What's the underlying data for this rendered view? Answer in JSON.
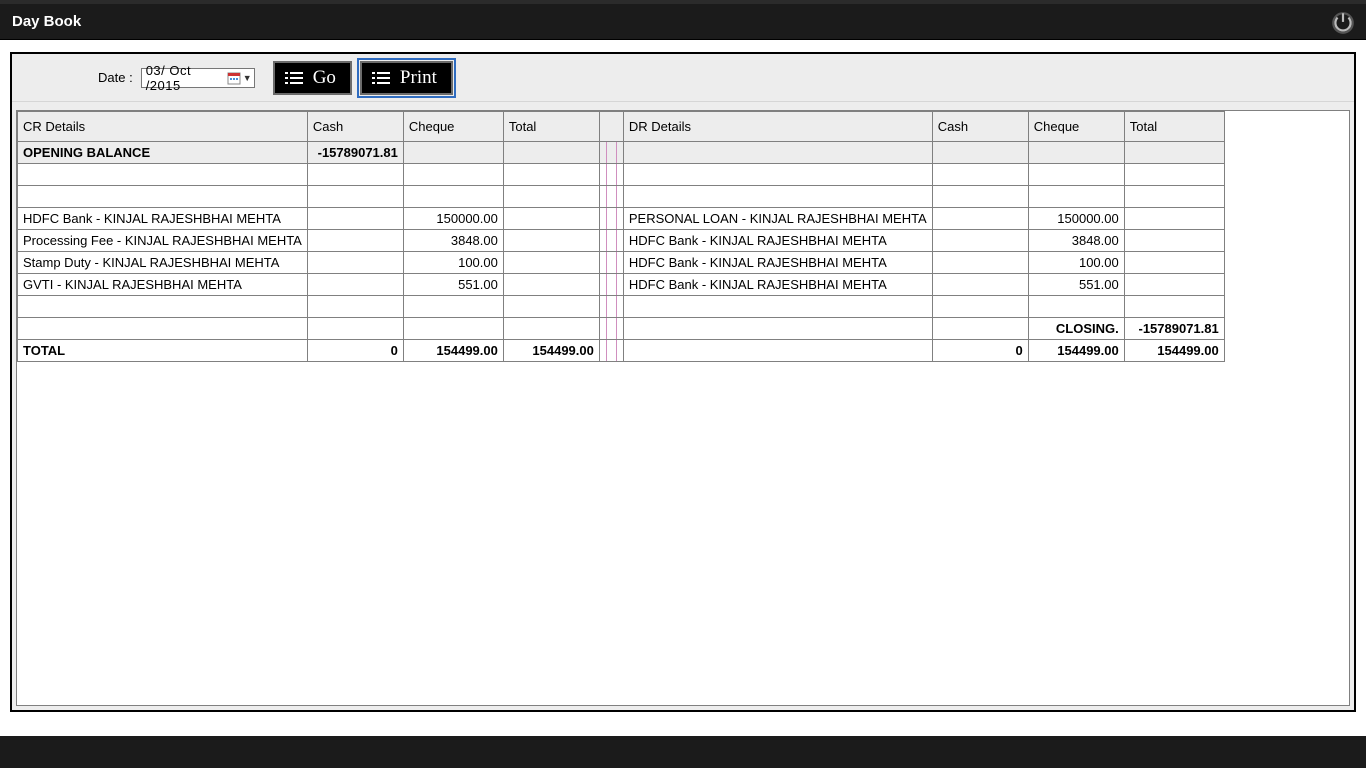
{
  "window": {
    "title": "Day Book"
  },
  "toolbar": {
    "date_label": "Date :",
    "date_value": "03/ Oct /2015",
    "go_label": "Go",
    "print_label": "Print"
  },
  "headers": {
    "cr_details": "CR Details",
    "cash": "Cash",
    "cheque": "Cheque",
    "total": "Total",
    "dr_details": "DR Details"
  },
  "rows": [
    {
      "type": "opening",
      "cr": "OPENING BALANCE",
      "cash_l": "-15789071.81",
      "cheque_l": "",
      "total_l": "",
      "dr": "",
      "cash_r": "",
      "cheque_r": "",
      "total_r": ""
    },
    {
      "type": "blank"
    },
    {
      "type": "blank"
    },
    {
      "type": "data",
      "cr": "HDFC Bank - KINJAL RAJESHBHAI  MEHTA",
      "cash_l": "",
      "cheque_l": "150000.00",
      "total_l": "",
      "dr": "PERSONAL LOAN - KINJAL RAJESHBHAI  MEHTA",
      "cash_r": "",
      "cheque_r": "150000.00",
      "total_r": ""
    },
    {
      "type": "data",
      "cr": "Processing Fee - KINJAL RAJESHBHAI  MEHTA",
      "cash_l": "",
      "cheque_l": "3848.00",
      "total_l": "",
      "dr": "HDFC Bank - KINJAL RAJESHBHAI  MEHTA",
      "cash_r": "",
      "cheque_r": "3848.00",
      "total_r": ""
    },
    {
      "type": "data",
      "cr": "Stamp Duty - KINJAL RAJESHBHAI  MEHTA",
      "cash_l": "",
      "cheque_l": "100.00",
      "total_l": "",
      "dr": "HDFC Bank - KINJAL RAJESHBHAI  MEHTA",
      "cash_r": "",
      "cheque_r": "100.00",
      "total_r": ""
    },
    {
      "type": "data",
      "cr": "GVTI - KINJAL RAJESHBHAI  MEHTA",
      "cash_l": "",
      "cheque_l": "551.00",
      "total_l": "",
      "dr": "HDFC Bank - KINJAL RAJESHBHAI  MEHTA",
      "cash_r": "",
      "cheque_r": "551.00",
      "total_r": ""
    },
    {
      "type": "blank"
    },
    {
      "type": "closing",
      "cr": "",
      "cash_l": "",
      "cheque_l": "",
      "total_l": "",
      "dr": "",
      "cash_r": "",
      "cheque_r": "CLOSING.",
      "total_r": "-15789071.81"
    },
    {
      "type": "total",
      "cr": "TOTAL",
      "cash_l": "0",
      "cheque_l": "154499.00",
      "total_l": "154499.00",
      "dr": "",
      "cash_r": "0",
      "cheque_r": "154499.00",
      "total_r": "154499.00"
    }
  ]
}
